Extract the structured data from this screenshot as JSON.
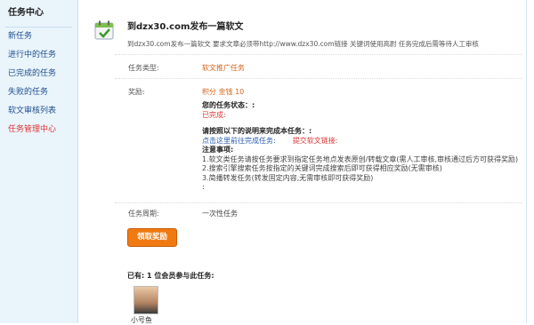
{
  "sidebar": {
    "title": "任务中心",
    "items": [
      {
        "label": "新任务"
      },
      {
        "label": "进行中的任务"
      },
      {
        "label": "已完成的任务"
      },
      {
        "label": "失败的任务"
      },
      {
        "label": "软文审核列表"
      },
      {
        "label": "任务管理中心"
      }
    ]
  },
  "task": {
    "icon": "task-checkmark-icon",
    "title": "到dzx30.com发布一篇软文",
    "description": "到dzx30.com发布一篇软文 要求文章必须带http://www.dzx30.com链接 关键词使用高尉 任务完成后需等待人工审核",
    "type_label": "任务类型:",
    "type_value": "软文推广任务",
    "reward_label": "奖励:",
    "reward_value": "积分 金钱 10",
    "status_heading": "您的任务状态：:",
    "status_value": "已完成:",
    "proof_heading": "请按照以下的说明来完成本任务：:",
    "proof_link": "点击这里前往完成任务:",
    "proof_submit": "提交软文链接:",
    "notes_heading": "注意事项:",
    "notes": [
      "1.软文类任务请按任务要求到指定任务地点发表原创/转载文章(需人工审核,审核通过后方可获得奖励)",
      "2.搜索引擎搜索任务按指定的关键词完成搜索后即可获得相应奖励(无需审核)",
      "3.简播转发任务(转发固定内容,无需审核即可获得奖励)",
      ":"
    ],
    "period_label": "任务周期:",
    "period_value": "一次性任务",
    "claim_button": "领取奖励",
    "participants": "已有: 1 位会员参与此任务:",
    "participant_name": "小号鱼"
  },
  "colors": {
    "accent": "#f07a12",
    "link": "#1d4f8c",
    "alert": "#dd3333"
  }
}
